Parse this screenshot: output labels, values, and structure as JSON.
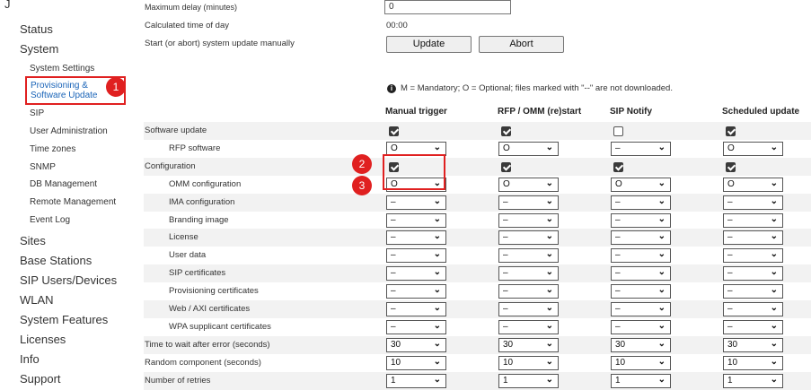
{
  "sidebar": {
    "top_fragment": "J",
    "items": [
      {
        "label": "Status",
        "level": 1
      },
      {
        "label": "System",
        "level": 1
      },
      {
        "label": "System Settings",
        "level": 2
      },
      {
        "label": "Provisioning & Software Update",
        "level": 2,
        "active": true
      },
      {
        "label": "SIP",
        "level": 2
      },
      {
        "label": "User Administration",
        "level": 2
      },
      {
        "label": "Time zones",
        "level": 2
      },
      {
        "label": "SNMP",
        "level": 2
      },
      {
        "label": "DB Management",
        "level": 2
      },
      {
        "label": "Remote Management",
        "level": 2
      },
      {
        "label": "Event Log",
        "level": 2
      },
      {
        "label": "Sites",
        "level": 1
      },
      {
        "label": "Base Stations",
        "level": 1
      },
      {
        "label": "SIP Users/Devices",
        "level": 1
      },
      {
        "label": "WLAN",
        "level": 1
      },
      {
        "label": "System Features",
        "level": 1
      },
      {
        "label": "Licenses",
        "level": 1
      },
      {
        "label": "Info",
        "level": 1
      },
      {
        "label": "Support",
        "level": 1
      }
    ],
    "active_line1": "Provisioning &",
    "active_line2": "Software Update"
  },
  "callouts": [
    "1",
    "2",
    "3"
  ],
  "top_settings": {
    "max_delay_label": "Maximum delay (minutes)",
    "max_delay_value": "0",
    "calc_time_label": "Calculated time of day",
    "calc_time_value": "00:00",
    "manual_label": "Start (or abort) system update manually",
    "update_button": "Update",
    "abort_button": "Abort"
  },
  "legend": {
    "text": "M = Mandatory; O = Optional; files marked with \"--\" are not downloaded."
  },
  "columns": [
    "Manual trigger",
    "RFP / OMM (re)start",
    "SIP Notify",
    "Scheduled update"
  ],
  "rows": [
    {
      "label": "Software update",
      "type": "checkbox",
      "values": [
        true,
        true,
        false,
        true
      ]
    },
    {
      "label": "RFP software",
      "type": "select",
      "values": [
        "O",
        "O",
        "–",
        "O"
      ]
    },
    {
      "label": "Configuration",
      "type": "checkbox",
      "values": [
        true,
        true,
        true,
        true
      ]
    },
    {
      "label": "OMM configuration",
      "type": "select",
      "values": [
        "O",
        "O",
        "O",
        "O"
      ]
    },
    {
      "label": "IMA configuration",
      "type": "select",
      "values": [
        "–",
        "–",
        "–",
        "–"
      ]
    },
    {
      "label": "Branding image",
      "type": "select",
      "values": [
        "–",
        "–",
        "–",
        "–"
      ]
    },
    {
      "label": "License",
      "type": "select",
      "values": [
        "–",
        "–",
        "–",
        "–"
      ]
    },
    {
      "label": "User data",
      "type": "select",
      "values": [
        "–",
        "–",
        "–",
        "–"
      ]
    },
    {
      "label": "SIP certificates",
      "type": "select",
      "values": [
        "–",
        "–",
        "–",
        "–"
      ]
    },
    {
      "label": "Provisioning certificates",
      "type": "select",
      "values": [
        "–",
        "–",
        "–",
        "–"
      ]
    },
    {
      "label": "Web / AXI certificates",
      "type": "select",
      "values": [
        "–",
        "–",
        "–",
        "–"
      ]
    },
    {
      "label": "WPA supplicant certificates",
      "type": "select",
      "values": [
        "–",
        "–",
        "–",
        "–"
      ]
    },
    {
      "label": "Time to wait after error (seconds)",
      "type": "select",
      "values": [
        "30",
        "30",
        "30",
        "30"
      ]
    },
    {
      "label": "Random component (seconds)",
      "type": "select",
      "values": [
        "10",
        "10",
        "10",
        "10"
      ]
    },
    {
      "label": "Number of retries",
      "type": "select",
      "values": [
        "1",
        "1",
        "1",
        "1"
      ]
    }
  ],
  "colors": {
    "highlight": "#e02020",
    "active_link": "#1a64b8"
  }
}
